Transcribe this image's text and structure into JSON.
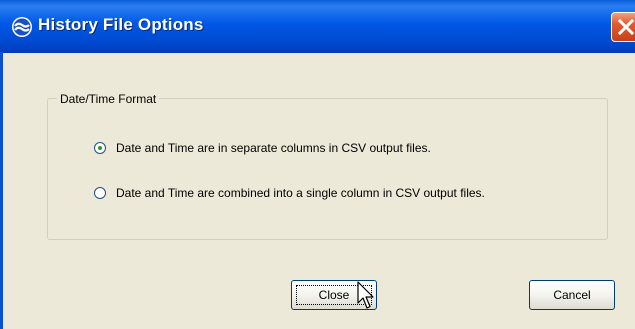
{
  "window": {
    "title": "History File Options",
    "app_icon": "globe-icon",
    "close_icon": "close-icon"
  },
  "groupbox": {
    "label": "Date/Time Format"
  },
  "options": [
    {
      "label": "Date and Time are in separate columns in CSV output files.",
      "selected": true
    },
    {
      "label": "Date and Time are combined into a single column in CSV output files.",
      "selected": false
    }
  ],
  "buttons": {
    "close_label": "Close",
    "cancel_label": "Cancel"
  },
  "colors": {
    "titlebar": "#0058e6",
    "dialog_background": "#ece9d8",
    "radio_dot": "#21a121",
    "close_button": "#e05a30"
  }
}
